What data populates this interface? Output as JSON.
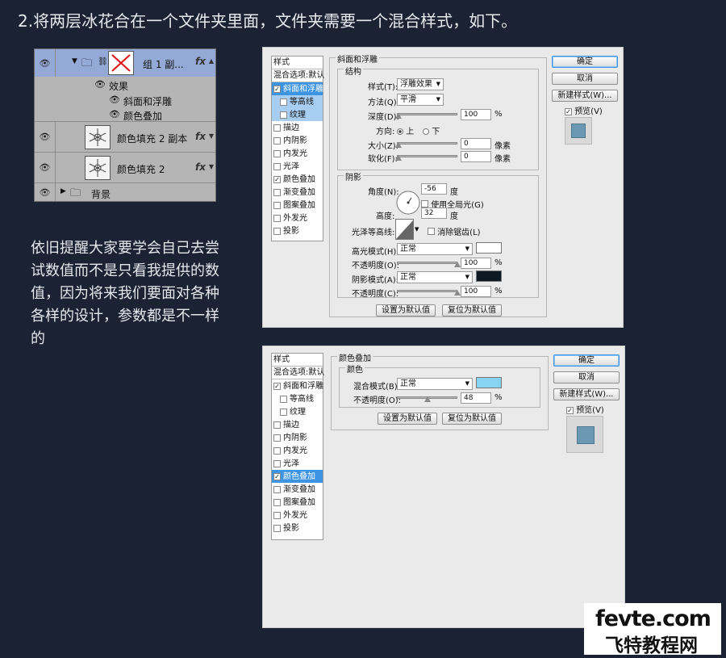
{
  "heading": "2.将两层冰花合在一个文件夹里面，文件夹需要一个混合样式，如下。",
  "body_text": "依旧提醒大家要学会自己去尝试数值而不是只看我提供的数值，因为将来我们要面对各种各样的设计，参数都是不一样的",
  "layers": {
    "group_name": "组 1 副...",
    "effects_label": "效果",
    "effect_items": [
      "斜面和浮雕",
      "颜色叠加"
    ],
    "layer1": "颜色填充 2 副本",
    "layer2": "颜色填充 2",
    "background": "背景",
    "fx": "fx"
  },
  "styles_list": {
    "title": "样式",
    "blend_default": "混合选项:默认",
    "items": [
      "斜面和浮雕",
      "等高线",
      "纹理",
      "描边",
      "内阴影",
      "内发光",
      "光泽",
      "颜色叠加",
      "渐变叠加",
      "图案叠加",
      "外发光",
      "投影"
    ]
  },
  "dialog1": {
    "section_title": "斜面和浮雕",
    "structure_title": "结构",
    "style_label": "样式(T):",
    "style_value": "浮雕效果",
    "method_label": "方法(Q):",
    "method_value": "平滑",
    "depth_label": "深度(D):",
    "depth_value": "100",
    "percent": "%",
    "direction_label": "方向:",
    "dir_up": "上",
    "dir_down": "下",
    "size_label": "大小(Z):",
    "size_value": "0",
    "soften_label": "软化(F):",
    "soften_value": "0",
    "px": "像素",
    "shading_title": "阴影",
    "angle_label": "角度(N):",
    "angle_value": "-56",
    "degree": "度",
    "global_light": "使用全局光(G)",
    "altitude_label": "高度:",
    "altitude_value": "32",
    "gloss_label": "光泽等高线:",
    "antialias": "消除锯齿(L)",
    "highlight_label": "高光模式(H):",
    "highlight_value": "正常",
    "opacity_label": "不透明度(O):",
    "highlight_opacity": "100",
    "shadow_label": "阴影模式(A):",
    "shadow_value": "正常",
    "opacity2_label": "不透明度(C):",
    "shadow_opacity": "100",
    "make_default": "设置为默认值",
    "reset_default": "复位为默认值"
  },
  "dialog2": {
    "section_title": "颜色叠加",
    "color_title": "颜色",
    "blend_label": "混合模式(B):",
    "blend_value": "正常",
    "opacity_label": "不透明度(O):",
    "opacity_value": "48",
    "percent": "%",
    "make_default": "设置为默认值",
    "reset_default": "复位为默认值"
  },
  "buttons": {
    "ok": "确定",
    "cancel": "取消",
    "new_style": "新建样式(W)...",
    "preview": "预览(V)"
  },
  "colors": {
    "highlight_color": "#ffffff",
    "shadow_color": "#0d1a24",
    "overlay_color": "#86d3f2",
    "preview_fill": "#6b98b3",
    "selected": "#3d94e3"
  },
  "logo": {
    "top": "fevte.com",
    "bottom": "飞特教程网"
  }
}
